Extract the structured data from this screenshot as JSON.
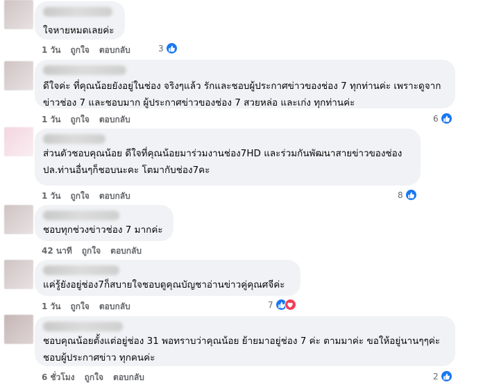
{
  "comments": [
    {
      "text": "ใจหายหมดเลยค่ะ",
      "time": "1 วัน",
      "like": "ถูกใจ",
      "reply": "ตอบกลับ",
      "reactions": "3"
    },
    {
      "text": "ดีใจค่ะ ที่คุณน้อยยังอยู่ในช่อง จริงๆแล้ว รักและชอบผู้ประกาศข่าวของช่อง 7 ทุกท่านค่ะ เพราะดูจากข่าวช่อง 7 และชอบมาก ผู้ประกาศข่าวของช่อง 7 สวยหล่อ และเก่ง ทุกท่านค่ะ",
      "time": "1 วัน",
      "like": "ถูกใจ",
      "reply": "ตอบกลับ",
      "reactions": "6"
    },
    {
      "text": "ส่วนตัวชอบคุณน้อย ดีใจที่คุณน้อยมาร่วมงานช่อง7HD และร่วมกันพัฒนาสายข่าวของช่อง ปล.ท่านอื่นๆก็ชอบนะคะ โตมากับช่อง7คะ",
      "time": "1 วัน",
      "like": "ถูกใจ",
      "reply": "ตอบกลับ",
      "reactions": "8"
    },
    {
      "text": "ชอบทุกช่วงข่าวช่อง 7 มากค่ะ",
      "time": "42 นาที",
      "like": "ถูกใจ",
      "reply": "ตอบกลับ",
      "reactions": ""
    },
    {
      "text": "แค่รู้ยังอยู่ช่อง7ก็สบายใจชอบดูคุณบัญชาอ่านข่าวคู่คุณศจีค่ะ",
      "time": "1 วัน",
      "like": "ถูกใจ",
      "reply": "ตอบกลับ",
      "reactions": "7"
    },
    {
      "text": "ชอบคุณน้อยตั้งแต่อยู่ช่อง 31 พอทราบว่าคุณน้อย ย้ายมาอยู่ช่อง 7 ค่ะ ตามมาค่ะ ขอให้อยู่นานๆๆค่ะ ชอบผู้ประกาศข่าว ทุกคนค่ะ",
      "time": "6 ชั่วโมง",
      "like": "ถูกใจ",
      "reply": "ตอบกลับ",
      "reactions": "2"
    }
  ],
  "colors": {
    "bubble": "#f0f2f5",
    "like": "#1877f2",
    "love": "#f33e58",
    "meta": "#65676b"
  }
}
